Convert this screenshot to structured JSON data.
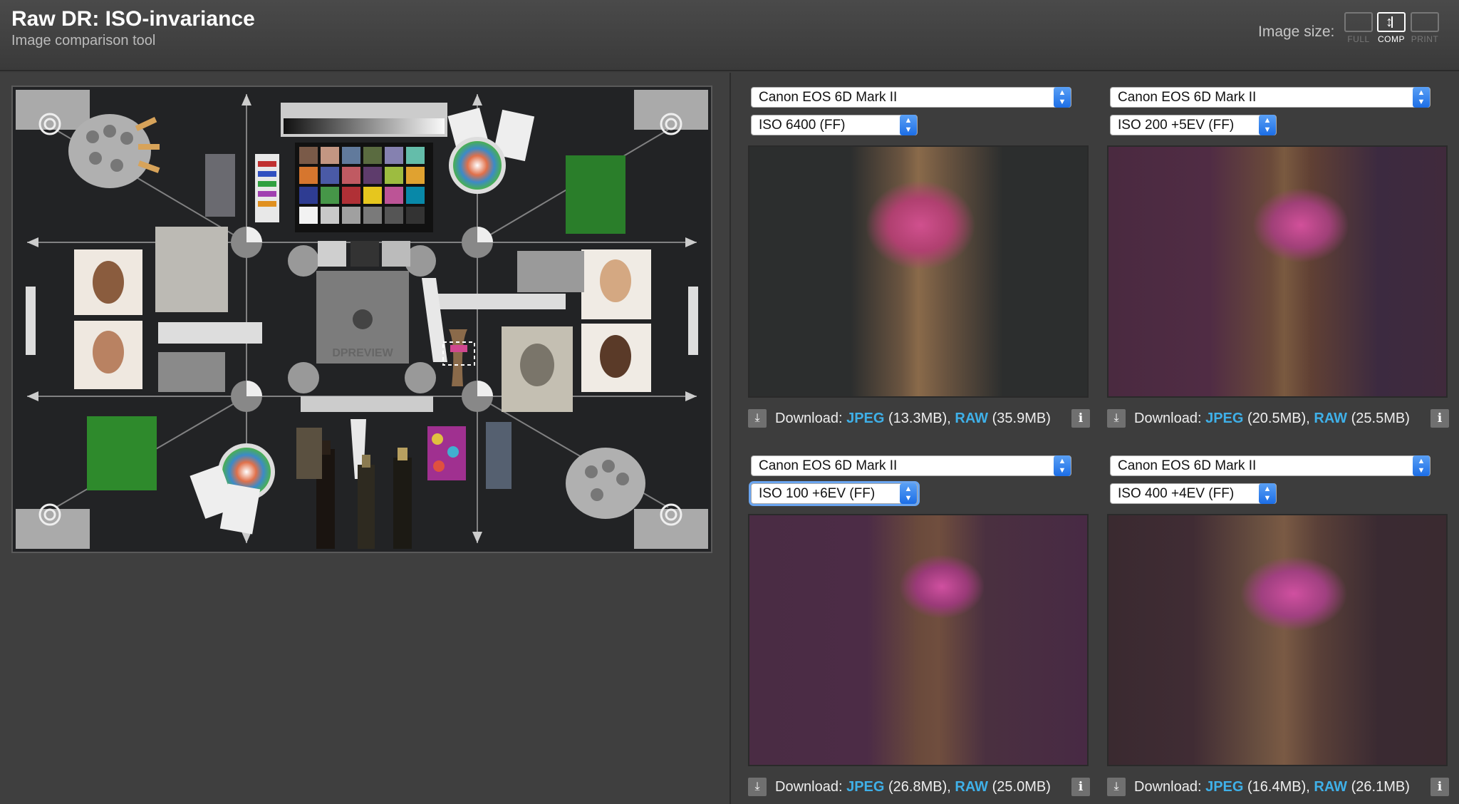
{
  "header": {
    "title": "Raw DR: ISO-invariance",
    "subtitle": "Image comparison tool",
    "image_size_label": "Image size:",
    "size_options": [
      {
        "label": "FULL",
        "active": false
      },
      {
        "label": "COMP",
        "active": true
      },
      {
        "label": "PRINT",
        "active": false
      }
    ]
  },
  "scene": {
    "name": "dpreview studio test scene",
    "watermark": "DPREVIEW"
  },
  "comparisons": [
    {
      "camera": "Canon EOS 6D Mark II",
      "setting": "ISO 6400 (FF)",
      "download_label": "Download:",
      "jpeg_label": "JPEG",
      "jpeg_size": "(13.3MB),",
      "raw_label": "RAW",
      "raw_size": "(35.9MB)"
    },
    {
      "camera": "Canon EOS 6D Mark II",
      "setting": "ISO 200 +5EV (FF)",
      "download_label": "Download:",
      "jpeg_label": "JPEG",
      "jpeg_size": "(20.5MB),",
      "raw_label": "RAW",
      "raw_size": "(25.5MB)"
    },
    {
      "camera": "Canon EOS 6D Mark II",
      "setting": "ISO 100 +6EV (FF)",
      "download_label": "Download:",
      "jpeg_label": "JPEG",
      "jpeg_size": "(26.8MB),",
      "raw_label": "RAW",
      "raw_size": "(25.0MB)"
    },
    {
      "camera": "Canon EOS 6D Mark II",
      "setting": "ISO 400 +4EV (FF)",
      "download_label": "Download:",
      "jpeg_label": "JPEG",
      "jpeg_size": "(16.4MB),",
      "raw_label": "RAW",
      "raw_size": "(26.1MB)"
    }
  ],
  "colors": {
    "accent_link": "#3fb0e8",
    "select_arrow": "#1c6ee6",
    "background": "#3d3d3d"
  }
}
